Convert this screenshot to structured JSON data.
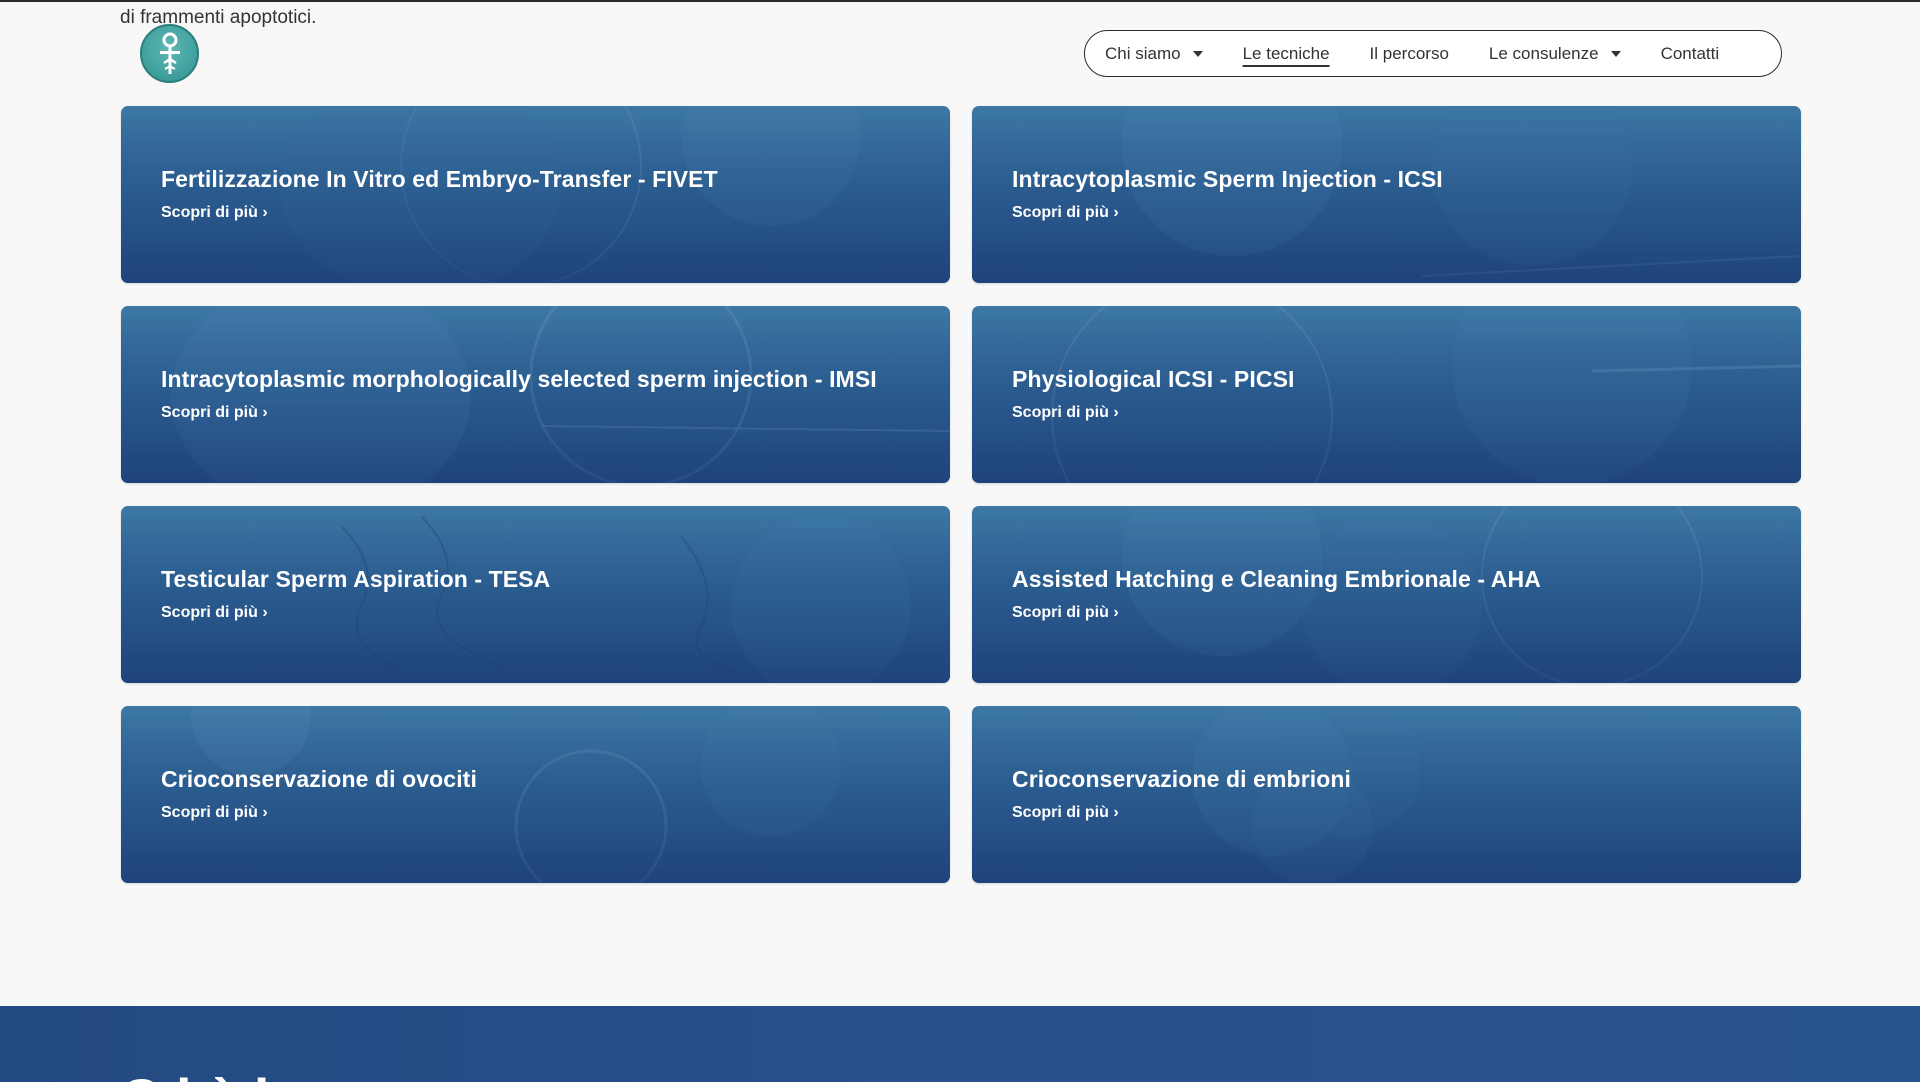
{
  "top_text": "di frammenti apoptotici.",
  "nav": {
    "items": [
      {
        "label": "Chi siamo",
        "dropdown": true,
        "active": false
      },
      {
        "label": "Le tecniche",
        "dropdown": false,
        "active": true
      },
      {
        "label": "Il percorso",
        "dropdown": false,
        "active": false
      },
      {
        "label": "Le consulenze",
        "dropdown": true,
        "active": false
      },
      {
        "label": "Contatti",
        "dropdown": false,
        "active": false
      }
    ]
  },
  "cards": [
    {
      "title": "Fertilizzazione In Vitro ed Embryo-Transfer - FIVET",
      "link": "Scopri di più ›"
    },
    {
      "title": "Intracytoplasmic Sperm Injection - ICSI",
      "link": "Scopri di più ›"
    },
    {
      "title": "Intracytoplasmic morphologically selected sperm injection - IMSI",
      "link": "Scopri di più ›"
    },
    {
      "title": "Physiological ICSI - PICSI",
      "link": "Scopri di più ›"
    },
    {
      "title": "Testicular Sperm Aspiration - TESA",
      "link": "Scopri di più ›"
    },
    {
      "title": "Assisted Hatching e Cleaning Embrionale - AHA",
      "link": "Scopri di più ›"
    },
    {
      "title": "Crioconservazione di ovociti",
      "link": "Scopri di più ›"
    },
    {
      "title": "Crioconservazione di embrioni",
      "link": "Scopri di più ›"
    }
  ],
  "footer": {
    "heading": "C   i          è  i"
  },
  "colors": {
    "logo": "#3e9e9b",
    "card_blue": "#2f6496",
    "footer_blue": "#28508a"
  }
}
